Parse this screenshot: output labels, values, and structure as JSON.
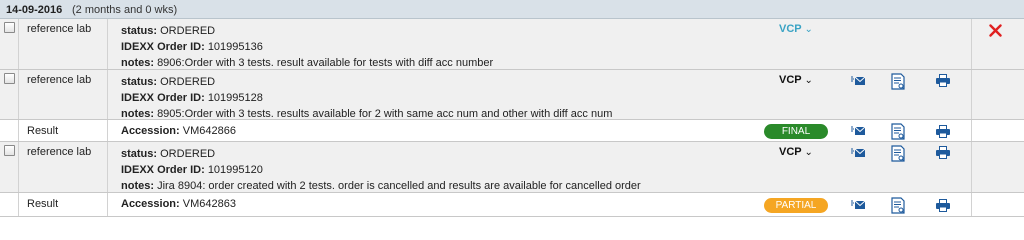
{
  "header": {
    "date": "14-09-2016",
    "span": "(2 months and 0 wks)"
  },
  "labels": {
    "status": "status:",
    "order_id": "IDEXX Order ID:",
    "notes": "notes:",
    "accession": "Accession:",
    "result": "Result"
  },
  "orders": [
    {
      "source": "reference lab",
      "status": "ORDERED",
      "order_id": "101995136",
      "notes": "8906:Order with 3 tests. result available for tests with diff acc number",
      "vcp": "VCP",
      "actions": [
        "delete-icon"
      ]
    },
    {
      "source": "reference lab",
      "status": "ORDERED",
      "order_id": "101995128",
      "notes": "8905:Order with 3 tests. results available for 2 with same acc num and other with diff acc num",
      "vcp": "VCP",
      "actions": [
        "email-icon",
        "document-view-icon",
        "print-icon"
      ]
    },
    {
      "source": "reference lab",
      "status": "ORDERED",
      "order_id": "101995120",
      "notes": "Jira 8904: order created with 2 tests. order is cancelled and results are available for cancelled order",
      "vcp": "VCP",
      "actions": [
        "email-icon",
        "document-view-icon",
        "print-icon"
      ]
    }
  ],
  "results": [
    {
      "label": "Result",
      "accession": "VM642866",
      "status": "FINAL",
      "status_color": "#2a8a2a"
    },
    {
      "label": "Result",
      "accession": "VM642863",
      "status": "PARTIAL",
      "status_color": "#f5a623"
    }
  ],
  "colors": {
    "header_bg": "#d9e1e8",
    "row_bg": "#f0f0f0",
    "vcp_active": "#3aa3c4",
    "icon_blue": "#1e5a9c",
    "delete_red": "#e02020"
  }
}
